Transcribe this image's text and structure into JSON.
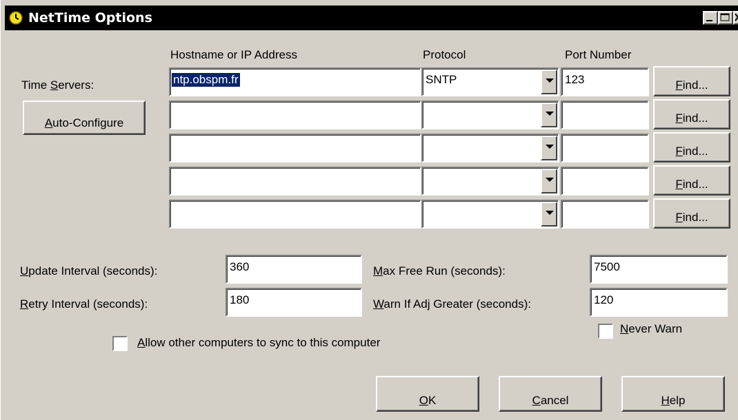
{
  "window": {
    "title": "NetTime Options"
  },
  "headers": {
    "host": "Hostname or IP Address",
    "protocol": "Protocol",
    "port": "Port Number"
  },
  "time_servers_label_pre": "Time ",
  "time_servers_label_key": "S",
  "time_servers_label_post": "ervers:",
  "auto_configure_key": "A",
  "auto_configure_rest": "uto-Configure",
  "servers": [
    {
      "host": "ntp.obspm.fr",
      "protocol": "SNTP",
      "port": "123"
    },
    {
      "host": "",
      "protocol": "",
      "port": ""
    },
    {
      "host": "",
      "protocol": "",
      "port": ""
    },
    {
      "host": "",
      "protocol": "",
      "port": ""
    },
    {
      "host": "",
      "protocol": "",
      "port": ""
    }
  ],
  "find_key": "F",
  "find_rest": "ind...",
  "update_interval": {
    "key": "U",
    "rest": "pdate Interval (seconds):",
    "value": "360"
  },
  "retry_interval": {
    "key": "R",
    "rest": "etry Interval (seconds):",
    "value": "180"
  },
  "max_free_run": {
    "key": "M",
    "rest": "ax Free Run (seconds):",
    "value": "7500"
  },
  "warn_if_adj": {
    "key": "W",
    "rest": "arn If Adj Greater (seconds):",
    "value": "120"
  },
  "never_warn": {
    "key": "N",
    "rest": "ever Warn"
  },
  "allow_sync": {
    "key": "A",
    "rest": "llow other computers to sync to this computer"
  },
  "buttons": {
    "ok_key": "O",
    "ok_rest": "K",
    "cancel_key": "C",
    "cancel_rest": "ancel",
    "help_key": "H",
    "help_rest": "elp"
  }
}
